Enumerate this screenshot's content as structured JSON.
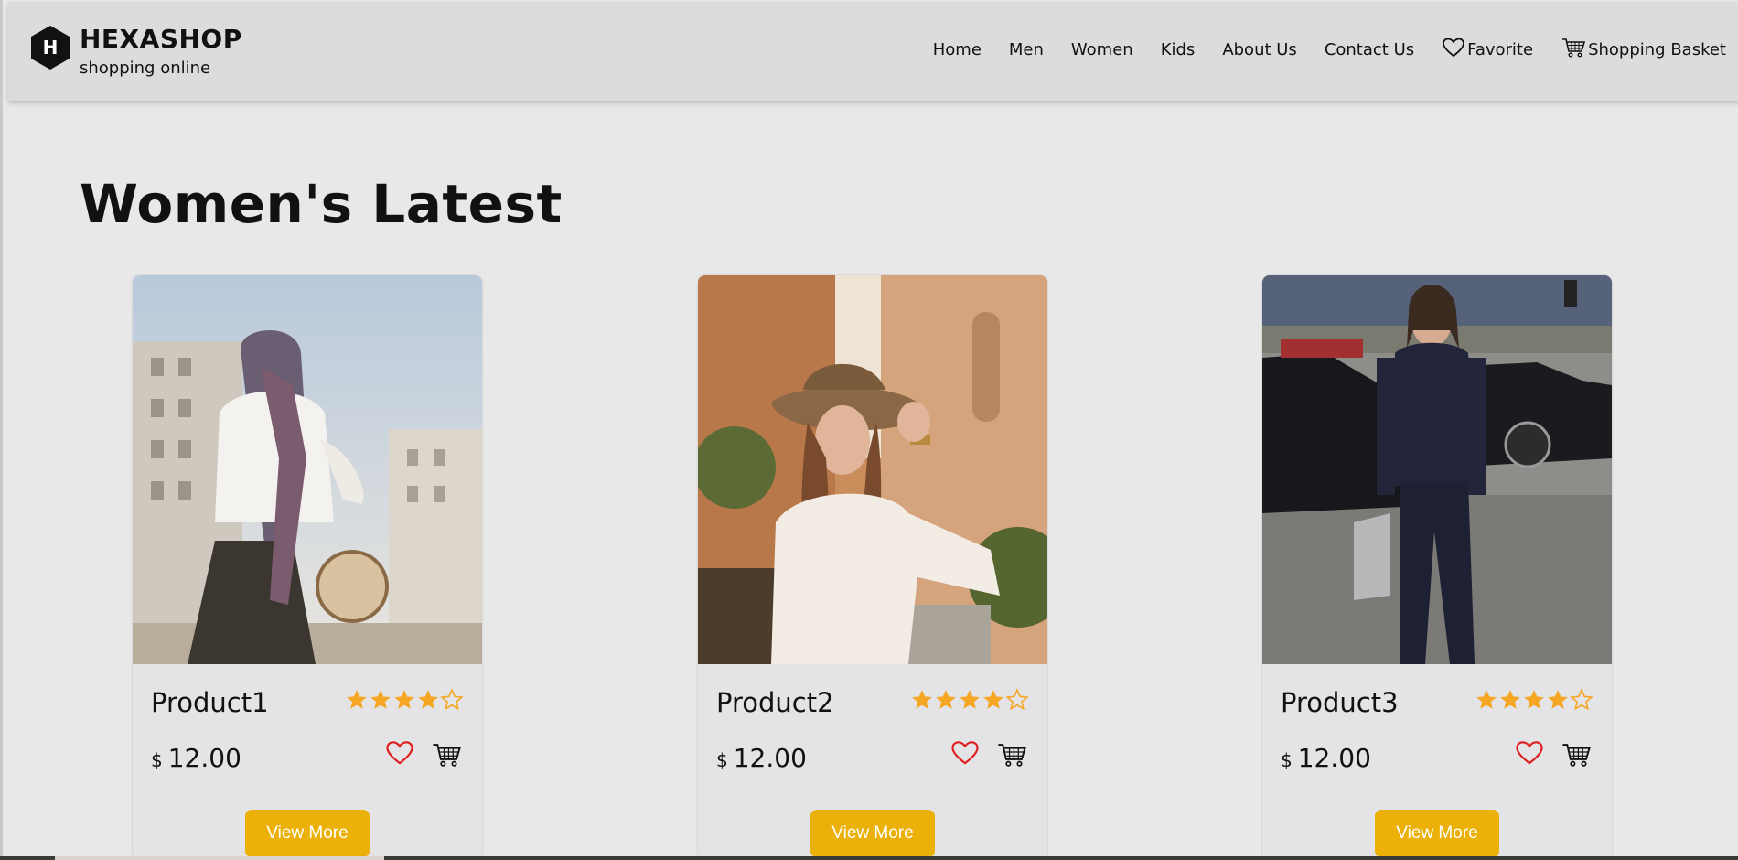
{
  "brand": {
    "name": "HEXASHOP",
    "tagline": "shopping online",
    "logo_letter": "H"
  },
  "nav": {
    "items": [
      {
        "label": "Home"
      },
      {
        "label": "Men"
      },
      {
        "label": "Women"
      },
      {
        "label": "Kids"
      },
      {
        "label": "About Us"
      },
      {
        "label": "Contact Us"
      },
      {
        "label": "Favorite",
        "icon": "heart-icon"
      },
      {
        "label": "Shopping Basket",
        "icon": "cart-icon"
      }
    ]
  },
  "section": {
    "title": "Women's Latest"
  },
  "products": [
    {
      "name": "Product1",
      "currency": "$",
      "price": "12.00",
      "rating": 4,
      "rating_max": 5,
      "button": "View More",
      "image": "woman-in-headscarf-photo"
    },
    {
      "name": "Product2",
      "currency": "$",
      "price": "12.00",
      "rating": 4,
      "rating_max": 5,
      "button": "View More",
      "image": "woman-in-hat-photo"
    },
    {
      "name": "Product3",
      "currency": "$",
      "price": "12.00",
      "rating": 4,
      "rating_max": 5,
      "button": "View More",
      "image": "woman-in-suit-photo"
    }
  ],
  "colors": {
    "page_bg": "#e8e8e8",
    "header_bg": "#dcdcdc",
    "accent_button": "#ecb109",
    "star": "#f5a623",
    "heart": "#e02020"
  }
}
